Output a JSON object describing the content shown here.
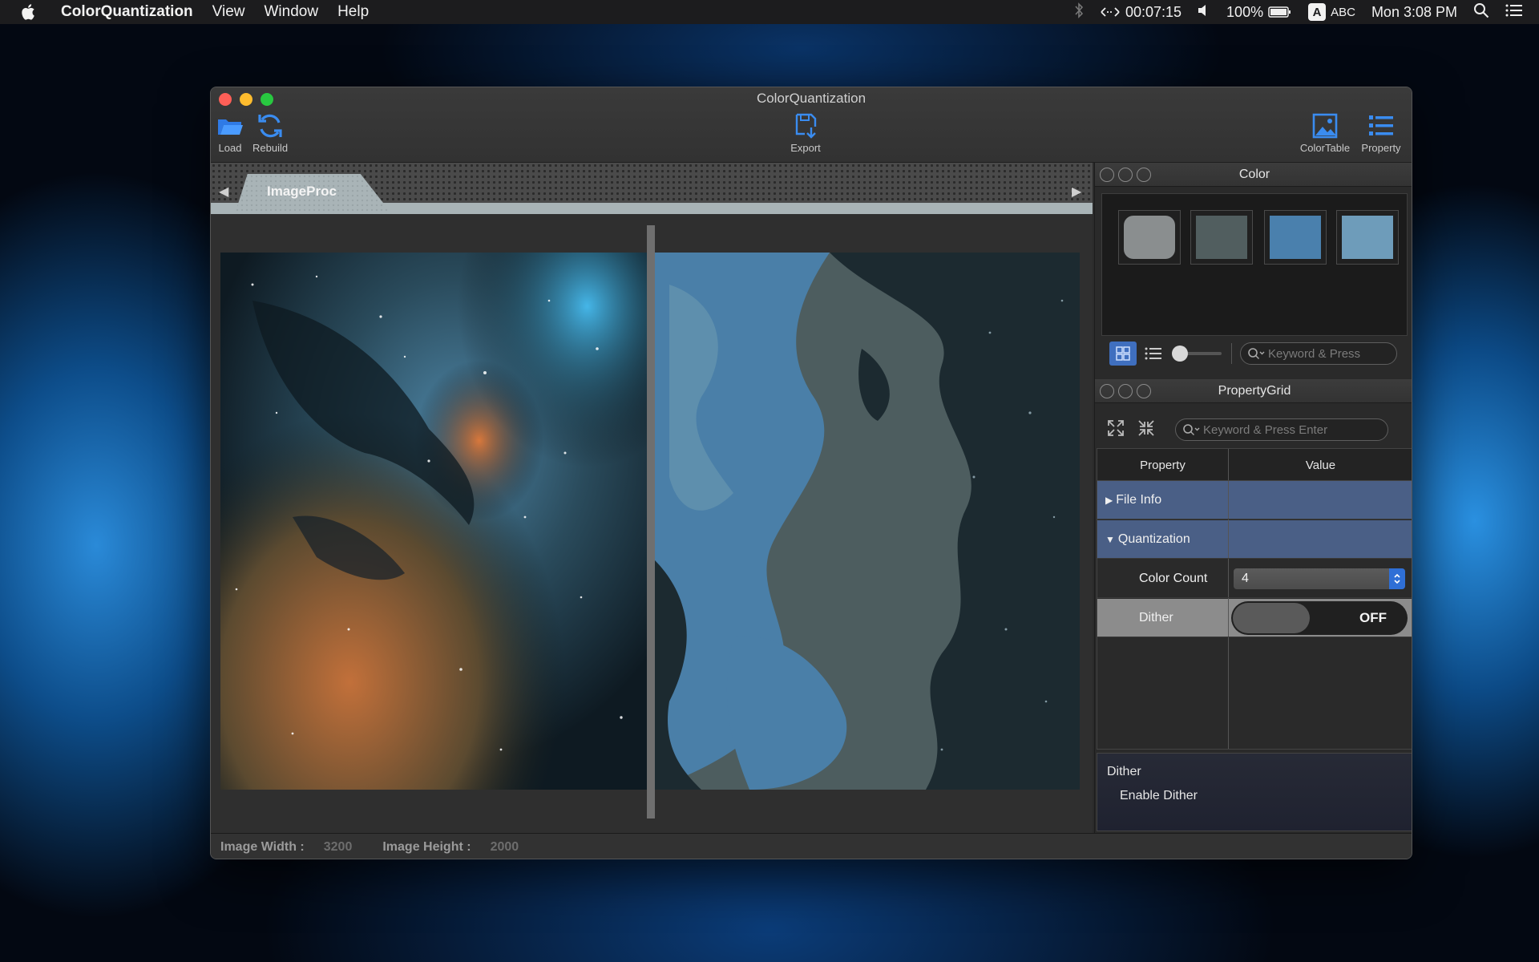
{
  "menubar": {
    "app_name": "ColorQuantization",
    "menus": [
      "View",
      "Window",
      "Help"
    ],
    "timer": "00:07:15",
    "battery": "100%",
    "input_source": "ABC",
    "input_glyph": "A",
    "clock": "Mon 3:08 PM"
  },
  "window": {
    "title": "ColorQuantization",
    "toolbar": {
      "load": "Load",
      "rebuild": "Rebuild",
      "export": "Export",
      "color_table": "ColorTable",
      "property": "Property"
    },
    "tab": "ImageProc",
    "status": {
      "width_label": "Image Width :",
      "width_value": "3200",
      "height_label": "Image Height :",
      "height_value": "2000"
    }
  },
  "color_panel": {
    "title": "Color",
    "swatches": [
      "#8a8e8f",
      "#515e5f",
      "#4a80ad",
      "#6e9cba"
    ],
    "search_placeholder": "Keyword & Press"
  },
  "property_grid": {
    "title": "PropertyGrid",
    "search_placeholder": "Keyword & Press Enter",
    "col_property": "Property",
    "col_value": "Value",
    "rows": {
      "file_info": "File Info",
      "quantization": "Quantization",
      "color_count_label": "Color Count",
      "color_count_value": "4",
      "dither_label": "Dither",
      "dither_value": "OFF"
    },
    "description": {
      "title": "Dither",
      "text": "Enable Dither"
    }
  }
}
